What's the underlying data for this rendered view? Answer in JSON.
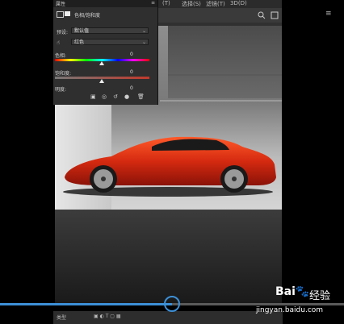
{
  "panel": {
    "title": "属性",
    "subtitle": "色相/饱和度",
    "preset_label": "预设:",
    "preset_value": "默认值",
    "channel_value": "红色",
    "hue_label": "色相:",
    "hue_value": "0",
    "sat_label": "饱和度:",
    "sat_value": "0",
    "light_label": "明度:",
    "light_value": "0",
    "menu_icon": "≡"
  },
  "menubar": {
    "item1": "(T)",
    "item2": "选择(S)",
    "item3": "滤镜(T)",
    "item4": "3D(D)"
  },
  "layers_bar": {
    "kind_label": "类型"
  },
  "video": {
    "progress_fraction": 0.5
  },
  "watermark": {
    "brand": "Bai",
    "brand2": "经验",
    "url": "jingyan.baidu.com"
  },
  "icons": {
    "search": "search-icon",
    "menu": "menu-icon",
    "eye": "eye-icon",
    "trash": "trash-icon"
  }
}
